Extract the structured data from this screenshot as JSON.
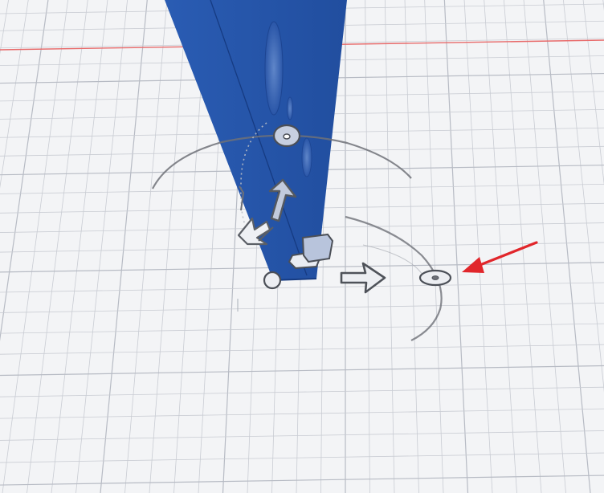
{
  "app": {
    "view": "3d-viewport",
    "workplane": "grid",
    "selected_shape": "blue-wedge"
  },
  "colors": {
    "background": "#f3f4f6",
    "grid_line": "#c9ccd3",
    "grid_major": "#b7bbc4",
    "axis_red": "#e45b5b",
    "shape_blue": "#2453a8",
    "shape_blue_dark": "#163b82",
    "handle_fill": "#b9c3d8",
    "handle_stroke": "#4b4f57",
    "annotation_arrow": "#e1262b"
  },
  "gizmo": {
    "handles": [
      {
        "id": "rotate-top",
        "icon": "rotate-handle-icon"
      },
      {
        "id": "move-up",
        "icon": "arrow-up-icon"
      },
      {
        "id": "scale-diagonal",
        "icon": "arrow-diagonal-icon"
      },
      {
        "id": "move-right",
        "icon": "arrow-right-icon"
      },
      {
        "id": "rotate-right",
        "icon": "rotate-handle-icon"
      },
      {
        "id": "corner-point",
        "icon": "corner-handle-icon"
      },
      {
        "id": "view-cube",
        "icon": "cube-icon"
      }
    ]
  },
  "annotation": {
    "icon": "red-pointer-arrow-icon",
    "target": "rotate-right"
  }
}
